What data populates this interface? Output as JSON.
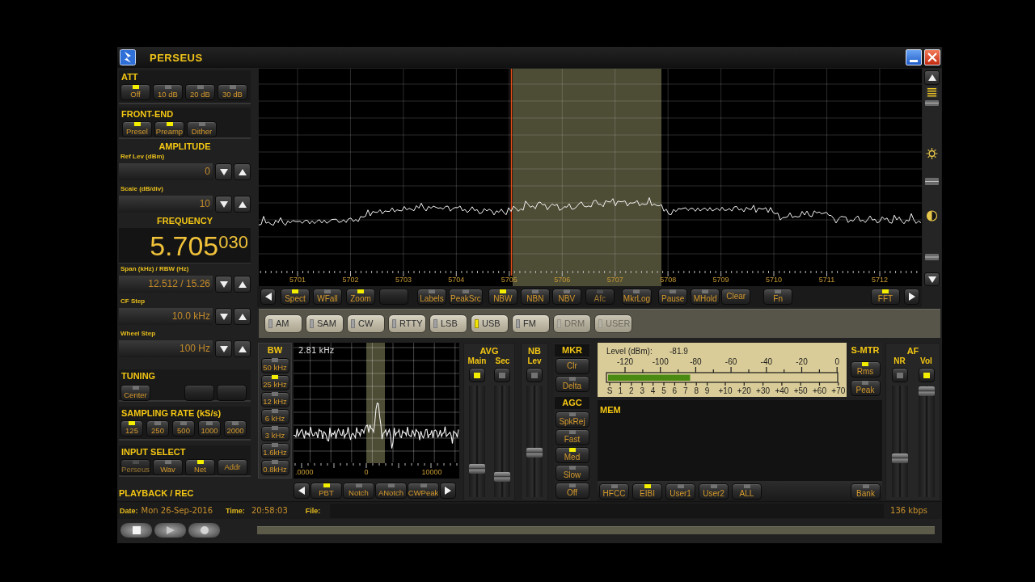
{
  "window": {
    "title": "PERSEUS"
  },
  "att": {
    "title": "ATT",
    "buttons": [
      {
        "label": "Off",
        "selected": true
      },
      {
        "label": "10 dB",
        "selected": false
      },
      {
        "label": "20 dB",
        "selected": false
      },
      {
        "label": "30 dB",
        "selected": false
      }
    ]
  },
  "front_end": {
    "title": "FRONT-END",
    "buttons": [
      {
        "label": "Presel",
        "on": true
      },
      {
        "label": "Preamp",
        "on": true
      },
      {
        "label": "Dither",
        "on": false
      }
    ]
  },
  "amplitude": {
    "title": "AMPLITUDE",
    "fields": [
      {
        "label": "Ref Lev (dBm)",
        "value": "0"
      },
      {
        "label": "Scale (dB/div)",
        "value": "10"
      }
    ]
  },
  "frequency": {
    "title": "FREQUENCY",
    "value": "5.705$^{030}$",
    "fields": [
      {
        "label": "Span (kHz) / RBW (Hz)",
        "value": "12.512 / 15.26"
      },
      {
        "label": "CF Step",
        "value": "10.0 kHz"
      },
      {
        "label": "Wheel Step",
        "value": "100 Hz"
      }
    ]
  },
  "tuning": {
    "title": "TUNING",
    "buttons": [
      {
        "kind": "led",
        "label": "Center",
        "on": false,
        "disabled": false
      },
      {
        "kind": "plain",
        "disabled": true
      },
      {
        "kind": "plain",
        "disabled": true
      }
    ]
  },
  "sampling_rate": {
    "title": "SAMPLING RATE (kS/s)",
    "buttons": [
      {
        "label": "125",
        "selected": true
      },
      {
        "label": "250",
        "selected": false
      },
      {
        "label": "500",
        "selected": false
      },
      {
        "label": "1000",
        "selected": false
      },
      {
        "label": "2000",
        "selected": false
      }
    ]
  },
  "input_select": {
    "title": "INPUT SELECT",
    "buttons": [
      {
        "kind": "led",
        "label": "Perseus",
        "selected": false,
        "disabled": true
      },
      {
        "kind": "led",
        "label": "Wav",
        "selected": false,
        "disabled": false
      },
      {
        "kind": "led",
        "label": "Net",
        "selected": true,
        "disabled": false
      },
      {
        "kind": "plain",
        "label": "Addr",
        "disabled": false
      }
    ]
  },
  "playback": {
    "title": "PLAYBACK / REC"
  },
  "spectrum": {
    "axis_labels": [
      "5701",
      "5702",
      "5703",
      "5704",
      "5705",
      "5706",
      "5707",
      "5708",
      "5709",
      "5710",
      "5711",
      "5712"
    ]
  },
  "spectrum_toolbar": [
    {
      "kind": "prev",
      "disabled": false
    },
    {
      "kind": "led",
      "label": "Spect",
      "on": true,
      "disabled": false
    },
    {
      "kind": "led",
      "label": "WFall",
      "on": false,
      "disabled": false
    },
    {
      "kind": "led",
      "label": "Zoom",
      "on": true,
      "disabled": false
    },
    {
      "kind": "plain",
      "disabled": true
    },
    {
      "kind": "led",
      "label": "Labels",
      "on": false,
      "disabled": false
    },
    {
      "kind": "led",
      "label": "PeakSrc",
      "on": false,
      "disabled": false
    },
    {
      "kind": "led",
      "label": "NBW",
      "on": true,
      "disabled": false
    },
    {
      "kind": "led",
      "label": "NBN",
      "on": false,
      "disabled": false
    },
    {
      "kind": "led",
      "label": "NBV",
      "on": false,
      "disabled": false
    },
    {
      "kind": "led",
      "label": "Afc",
      "on": false,
      "disabled": true
    },
    {
      "kind": "led",
      "label": "MkrLog",
      "on": false,
      "disabled": false
    },
    {
      "kind": "led",
      "label": "Pause",
      "on": false,
      "disabled": false
    },
    {
      "kind": "led",
      "label": "MHold",
      "on": false,
      "disabled": false
    },
    {
      "kind": "plain",
      "label": "Clear",
      "disabled": false
    },
    {
      "kind": "led",
      "label": "Fn",
      "on": false,
      "disabled": false
    },
    {
      "kind": "led",
      "label": "FFT",
      "on": true,
      "disabled": false
    },
    {
      "kind": "next",
      "disabled": false
    }
  ],
  "modes": [
    {
      "label": "AM",
      "selected": false,
      "disabled": false
    },
    {
      "label": "SAM",
      "selected": false,
      "disabled": false
    },
    {
      "label": "CW",
      "selected": false,
      "disabled": false
    },
    {
      "label": "RTTY",
      "selected": false,
      "disabled": false
    },
    {
      "label": "LSB",
      "selected": false,
      "disabled": false
    },
    {
      "label": "USB",
      "selected": true,
      "disabled": false
    },
    {
      "label": "FM",
      "selected": false,
      "disabled": false
    },
    {
      "label": "DRM",
      "selected": false,
      "disabled": true
    },
    {
      "label": "USER",
      "selected": false,
      "disabled": true
    }
  ],
  "bw": {
    "title": "BW",
    "buttons": [
      {
        "label": "50 kHz",
        "selected": false
      },
      {
        "label": "25 kHz",
        "selected": true
      },
      {
        "label": "12 kHz",
        "selected": false
      },
      {
        "label": "6 kHz",
        "selected": false
      },
      {
        "label": "3 kHz",
        "selected": false
      },
      {
        "label": "1.6kHz",
        "selected": false
      },
      {
        "label": "0.8kHz",
        "selected": false
      }
    ]
  },
  "zoom_spectrum": {
    "bandwidth": "2.81 kHz",
    "axis_labels": [
      ".0000",
      "0",
      "10000"
    ]
  },
  "zoom_toolbar": [
    {
      "kind": "prev"
    },
    {
      "kind": "led",
      "label": "PBT",
      "on": true
    },
    {
      "kind": "led",
      "label": "Notch",
      "on": false
    },
    {
      "kind": "led",
      "label": "ANotch",
      "on": false
    },
    {
      "kind": "led",
      "label": "CWPeak",
      "on": false
    },
    {
      "kind": "next"
    }
  ],
  "avg": {
    "title": "AVG",
    "sliders": [
      {
        "label": "Main",
        "on": true,
        "level": 0.23
      },
      {
        "label": "Sec",
        "on": false,
        "level": 0.15
      }
    ]
  },
  "nb": {
    "title": "NB",
    "sliders": [
      {
        "label": "Lev",
        "on": false,
        "level": 0.39
      }
    ]
  },
  "mkr": {
    "title": "MKR",
    "buttons": [
      {
        "kind": "plain",
        "label": "Clr"
      },
      {
        "kind": "led",
        "label": "Delta",
        "on": false
      }
    ]
  },
  "agc": {
    "title": "AGC",
    "buttons": [
      {
        "label": "SpkRej",
        "selected": false
      },
      {
        "label": "Fast",
        "selected": false
      },
      {
        "label": "Med",
        "selected": true
      },
      {
        "label": "Slow",
        "selected": false
      },
      {
        "label": "Off",
        "selected": false
      }
    ]
  },
  "s_meter": {
    "level_label": "Level (dBm):",
    "reading": "-81.9",
    "dbm_scale": [
      "-120",
      "-100",
      "-80",
      "-60",
      "-40",
      "-20",
      "0"
    ],
    "s_scale": [
      "S",
      "1",
      "2",
      "3",
      "4",
      "5",
      "6",
      "7",
      "8",
      "9",
      "+10",
      "+20",
      "+30",
      "+40",
      "+50",
      "+60",
      "+70"
    ],
    "level": 0.36
  },
  "s_mtr": {
    "title": "S-MTR",
    "buttons": [
      {
        "label": "Rms",
        "selected": true
      },
      {
        "label": "Peak",
        "selected": false
      }
    ]
  },
  "mem": {
    "title": "MEM",
    "buttons": [
      {
        "label": "HFCC",
        "on": false
      },
      {
        "label": "EIBI",
        "on": true
      },
      {
        "label": "User1",
        "on": false
      },
      {
        "label": "User2",
        "on": false
      },
      {
        "label": "ALL",
        "on": false
      },
      {
        "label": "Bank",
        "on": false
      }
    ]
  },
  "af": {
    "title": "AF",
    "sliders": [
      {
        "label": "NR",
        "on": false,
        "level": 0.33
      },
      {
        "label": "Vol",
        "on": true,
        "level": 0.99
      }
    ]
  },
  "status_bar": {
    "date_label": "Date:",
    "date": "Mon 26-Sep-2016",
    "time_label": "Time:",
    "time": "20:58:03",
    "file_label": "File:",
    "bitrate": "136 kbps"
  }
}
